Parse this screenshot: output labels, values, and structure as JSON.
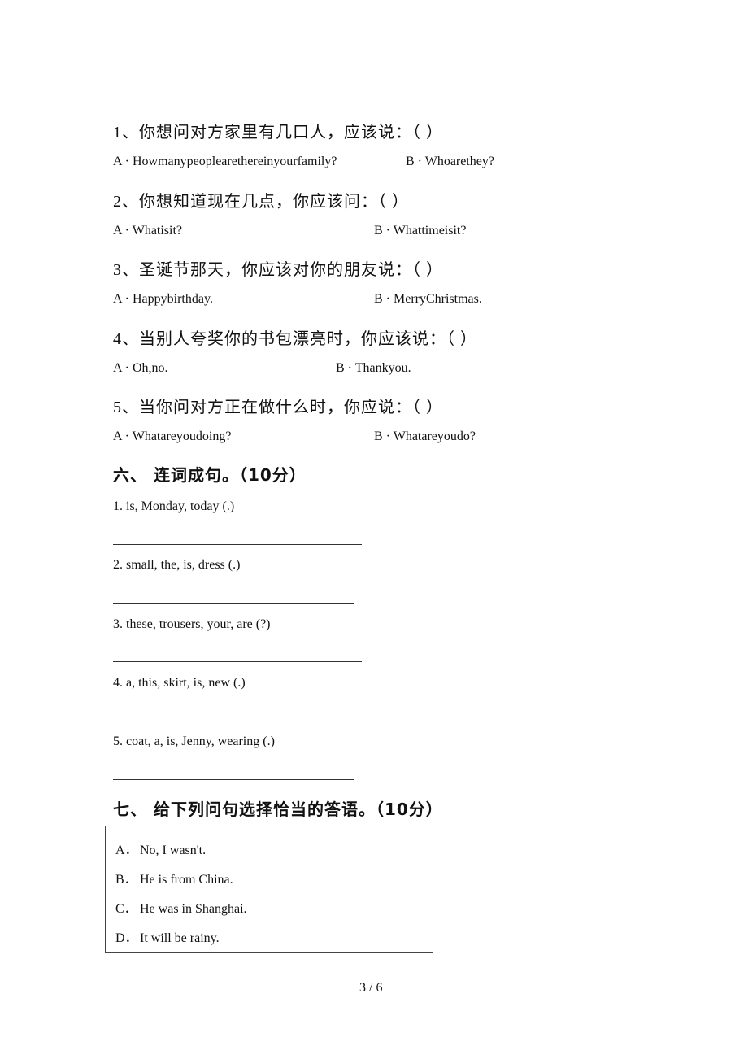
{
  "questions": [
    {
      "prompt": "1、你想问对方家里有几口人，应该说：（      ）",
      "a": "A · Howmanypeoplearethereinyourfamily?",
      "b": "B · Whoarethey?"
    },
    {
      "prompt": "2、你想知道现在几点，你应该问：（      ）",
      "a": "A · Whatisit?",
      "b": "B · Whattimeisit?"
    },
    {
      "prompt": "3、圣诞节那天，你应该对你的朋友说：（      ）",
      "a": "A · Happybirthday.",
      "b": "B · MerryChristmas."
    },
    {
      "prompt": "4、当别人夸奖你的书包漂亮时，你应该说：（      ）",
      "a": "A · Oh,no.",
      "b": "B · Thankyou."
    },
    {
      "prompt": "5、当你问对方正在做什么时，你应说：（      ）",
      "a": "A · Whatareyoudoing?",
      "b": "B · Whatareyoudo?"
    }
  ],
  "section6": {
    "heading": "六、  连词成句。（10分）",
    "items": [
      "1. is, Monday, today (.)",
      "2. small, the, is, dress (.)",
      "3. these, trousers, your, are (?)",
      "4. a, this, skirt, is, new (.)",
      "5. coat, a, is, Jenny, wearing (.)"
    ]
  },
  "section7": {
    "heading": "七、  给下列问句选择恰当的答语。（10分）",
    "choices": [
      {
        "label": "A．",
        "text": "No, I wasn't."
      },
      {
        "label": "B．",
        "text": "He is from China."
      },
      {
        "label": "C．",
        "text": "He was in Shanghai."
      },
      {
        "label": "D．",
        "text": "It will be rainy."
      }
    ]
  },
  "footer": {
    "page": "3 / 6"
  }
}
